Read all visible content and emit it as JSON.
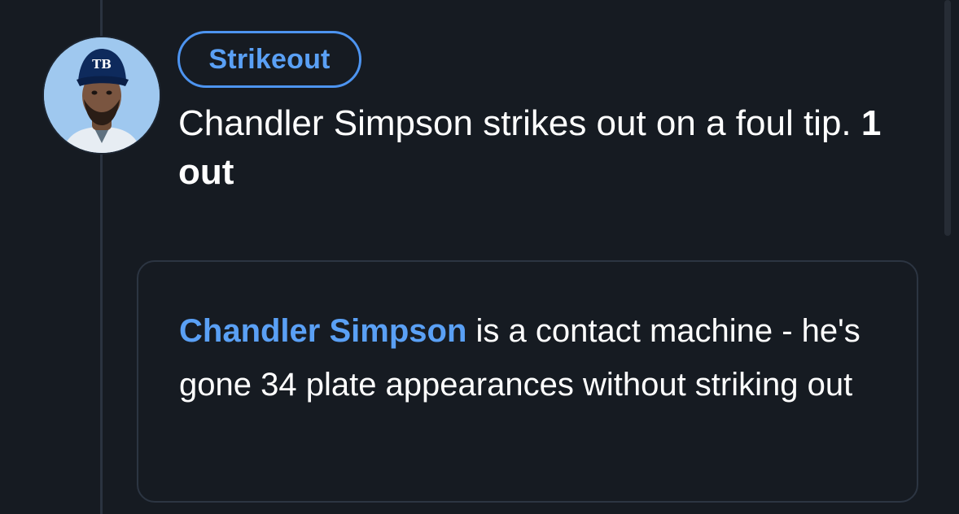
{
  "event": {
    "badge": "Strikeout",
    "player_avatar_icon": "player-headshot-icon",
    "team_logo_text": "TB",
    "description_main": "Chandler Simpson strikes out on a foul tip. ",
    "description_outs": "1 out"
  },
  "insight": {
    "player_link": "Chandler Simpson",
    "text": " is a contact machine - he's gone 34 plate appearances without striking out"
  },
  "colors": {
    "background": "#161b22",
    "accent": "#5aa0f5",
    "timeline": "#2b3340",
    "card_border": "#2c3542"
  }
}
